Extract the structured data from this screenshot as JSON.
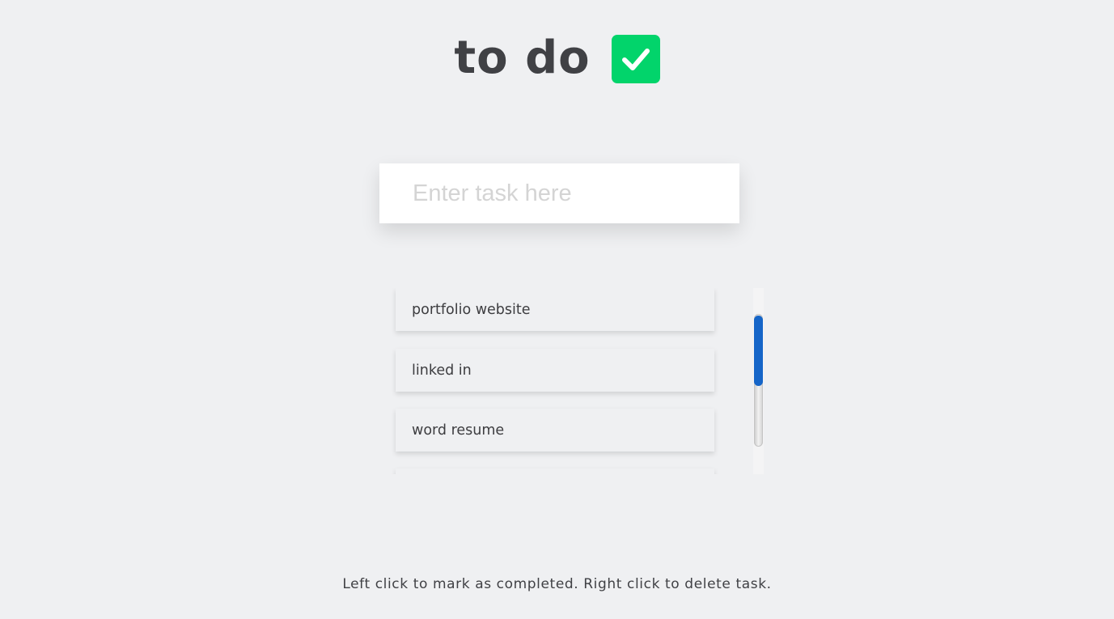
{
  "header": {
    "title": "to do",
    "check_icon": "check-icon",
    "check_color": "#02d46b"
  },
  "task_input": {
    "value": "",
    "placeholder": "Enter task here"
  },
  "tasks": [
    {
      "label": "portfolio website"
    },
    {
      "label": "linked in"
    },
    {
      "label": "word resume"
    }
  ],
  "scrollbar": {
    "thumb_color": "#1565c8"
  },
  "footer": {
    "hint": "Left click to mark as completed. Right click to delete task."
  }
}
